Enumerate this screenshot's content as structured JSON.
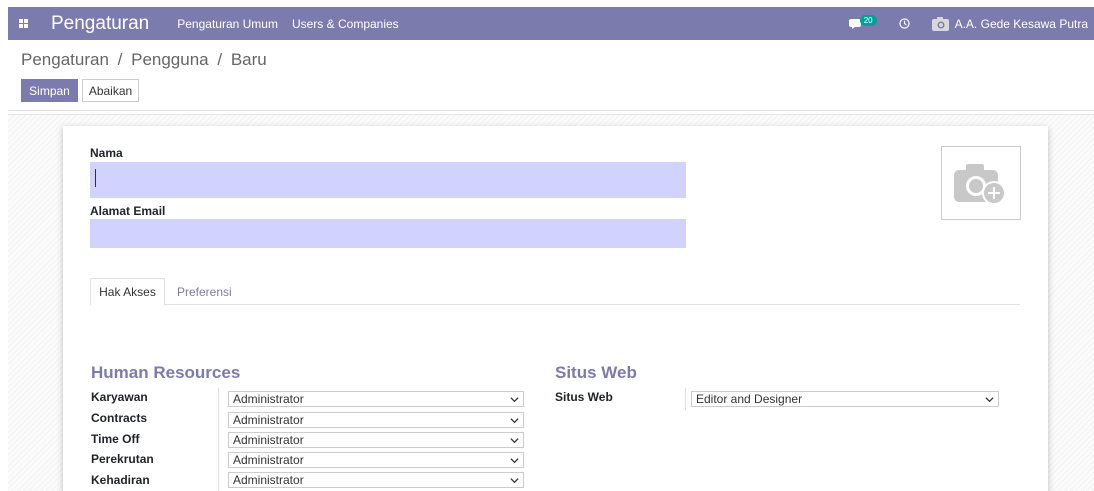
{
  "navbar": {
    "app_title": "Pengaturan",
    "menu": [
      "Pengaturan Umum",
      "Users & Companies"
    ],
    "chat_count": "20",
    "user_name": "A.A. Gede Kesawa Putra"
  },
  "breadcrumb": {
    "parts": [
      "Pengaturan",
      "Pengguna",
      "Baru"
    ],
    "separator": "/"
  },
  "actions": {
    "save": "Simpan",
    "discard": "Abaikan"
  },
  "form": {
    "name_label": "Nama",
    "name_value": "",
    "email_label": "Alamat Email",
    "email_value": ""
  },
  "tabs": [
    {
      "label": "Hak Akses",
      "active": true
    },
    {
      "label": "Preferensi",
      "active": false
    }
  ],
  "sections": {
    "hr": {
      "title": "Human Resources",
      "rows": [
        {
          "label": "Karyawan",
          "value": "Administrator"
        },
        {
          "label": "Contracts",
          "value": "Administrator"
        },
        {
          "label": "Time Off",
          "value": "Administrator"
        },
        {
          "label": "Perekrutan",
          "value": "Administrator"
        },
        {
          "label": "Kehadiran",
          "value": "Administrator"
        }
      ]
    },
    "website": {
      "title": "Situs Web",
      "rows": [
        {
          "label": "Situs Web",
          "value": "Editor and Designer"
        }
      ]
    }
  },
  "colors": {
    "brand": "#7c7bad",
    "field_bg": "#d2d2ff",
    "badge": "#00a09d"
  }
}
